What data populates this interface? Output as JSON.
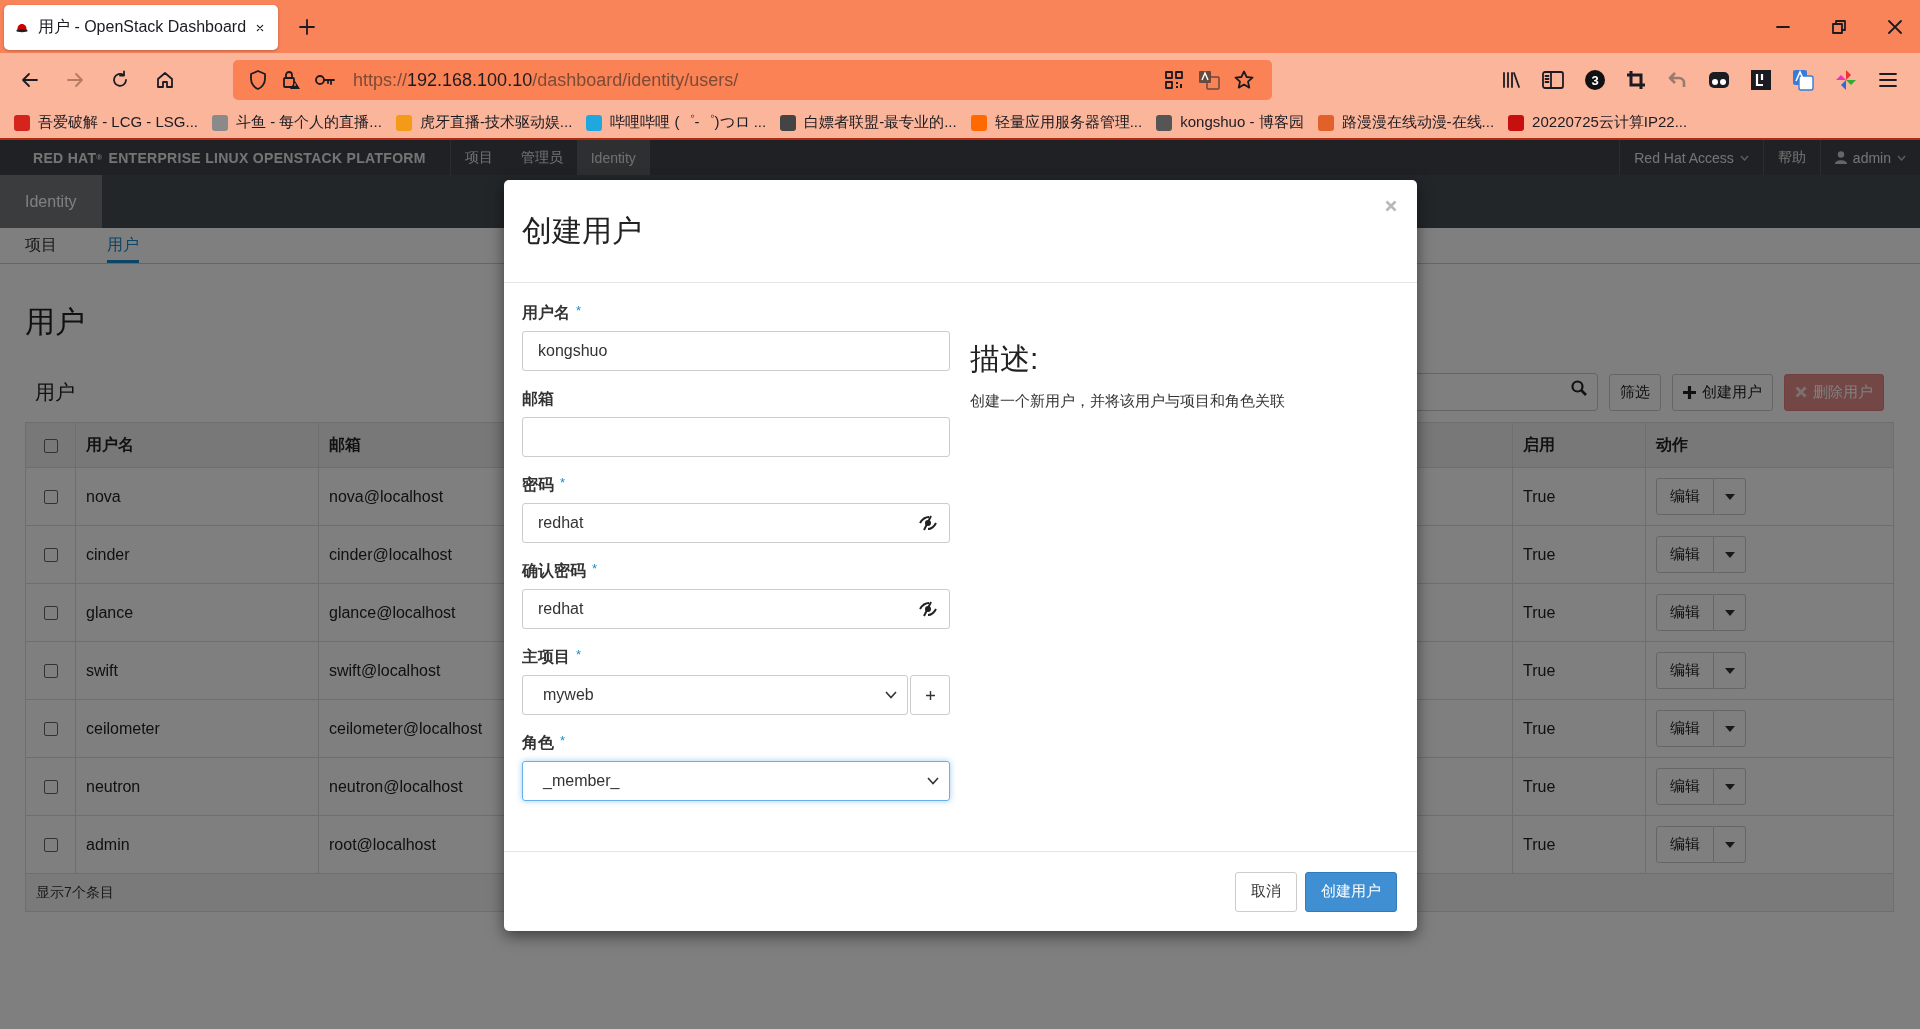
{
  "browser": {
    "tab": {
      "title": "用户 - OpenStack Dashboard"
    },
    "nav_buttons": [
      {
        "kind": "back",
        "disabled": false
      },
      {
        "kind": "forward",
        "disabled": true
      },
      {
        "kind": "reload",
        "disabled": false
      },
      {
        "kind": "home",
        "disabled": false
      }
    ],
    "url": {
      "scheme": "https://",
      "host": "192.168.100.10",
      "path": "/dashboard/identity/users/"
    },
    "toolbar_badge": "3",
    "bookmarks": [
      {
        "label": "吾爱破解 - LCG - LSG..."
      },
      {
        "label": "斗鱼 - 每个人的直播..."
      },
      {
        "label": "虎牙直播-技术驱动娱..."
      },
      {
        "label": "哔哩哔哩 (゜-゜)つロ ..."
      },
      {
        "label": "白嫖者联盟-最专业的..."
      },
      {
        "label": "轻量应用服务器管理..."
      },
      {
        "label": "kongshuo - 博客园"
      },
      {
        "label": "路漫漫在线动漫-在线..."
      },
      {
        "label": "20220725云计算IP22..."
      }
    ]
  },
  "navbar": {
    "brand": "RED HAT$^{®}$ ENTERPRISE LINUX OPENSTACK PLATFORM",
    "menu": [
      {
        "label": "项目",
        "selected": false
      },
      {
        "label": "管理员",
        "selected": false
      },
      {
        "label": "Identity",
        "selected": true
      }
    ],
    "right": [
      {
        "label": "Red Hat Access",
        "kind": "dropdown"
      },
      {
        "label": "帮助",
        "kind": "link"
      },
      {
        "label": "admin",
        "kind": "user"
      }
    ]
  },
  "panel_tabs": [
    {
      "label": "Identity",
      "selected": true
    }
  ],
  "subnav": [
    {
      "label": "项目",
      "selected": false
    },
    {
      "label": "用户",
      "selected": true
    }
  ],
  "page_title": "用户",
  "table": {
    "title": "用户",
    "actions": [
      {
        "label": "筛选",
        "kind": "filter",
        "disabled": false
      },
      {
        "label": "创建用户",
        "kind": "create",
        "disabled": false
      },
      {
        "label": "删除用户",
        "kind": "delete",
        "disabled": true
      }
    ],
    "select_all_checked": false,
    "columns": [
      "用户名",
      "邮箱",
      "启用",
      "动作"
    ],
    "rows": [
      {
        "name": "nova",
        "email": "nova@localhost",
        "enabled": "True",
        "action": "编辑",
        "checked": false
      },
      {
        "name": "cinder",
        "email": "cinder@localhost",
        "enabled": "True",
        "action": "编辑",
        "checked": false
      },
      {
        "name": "glance",
        "email": "glance@localhost",
        "enabled": "True",
        "action": "编辑",
        "checked": false
      },
      {
        "name": "swift",
        "email": "swift@localhost",
        "enabled": "True",
        "action": "编辑",
        "checked": false
      },
      {
        "name": "ceilometer",
        "email": "ceilometer@localhost",
        "enabled": "True",
        "action": "编辑",
        "checked": false
      },
      {
        "name": "neutron",
        "email": "neutron@localhost",
        "enabled": "True",
        "action": "编辑",
        "checked": false
      },
      {
        "name": "admin",
        "email": "root@localhost",
        "enabled": "True",
        "action": "编辑",
        "checked": false
      }
    ],
    "footer": "显示7个条目"
  },
  "modal": {
    "title": "创建用户",
    "fields": [
      {
        "label": "用户名",
        "required_mark": "*",
        "kind": "text",
        "value": "kongshuo",
        "focused": false
      },
      {
        "label": "邮箱",
        "kind": "text",
        "focused": false
      },
      {
        "label": "密码",
        "required_mark": "*",
        "kind": "password",
        "value": "redhat",
        "focused": false
      },
      {
        "label": "确认密码",
        "required_mark": "*",
        "kind": "password",
        "value": "redhat",
        "focused": false
      },
      {
        "label": "主项目",
        "required_mark": "*",
        "kind": "select",
        "value": "myweb",
        "add_button": true,
        "focused": false
      },
      {
        "label": "角色",
        "required_mark": "*",
        "kind": "select",
        "value": "_member_",
        "focused": true
      }
    ],
    "description": {
      "heading": "描述:",
      "text": "创建一个新用户，并将该用户与项目和角色关联"
    },
    "buttons": [
      {
        "label": "取消",
        "kind": "default"
      },
      {
        "label": "创建用户",
        "kind": "primary"
      }
    ]
  }
}
